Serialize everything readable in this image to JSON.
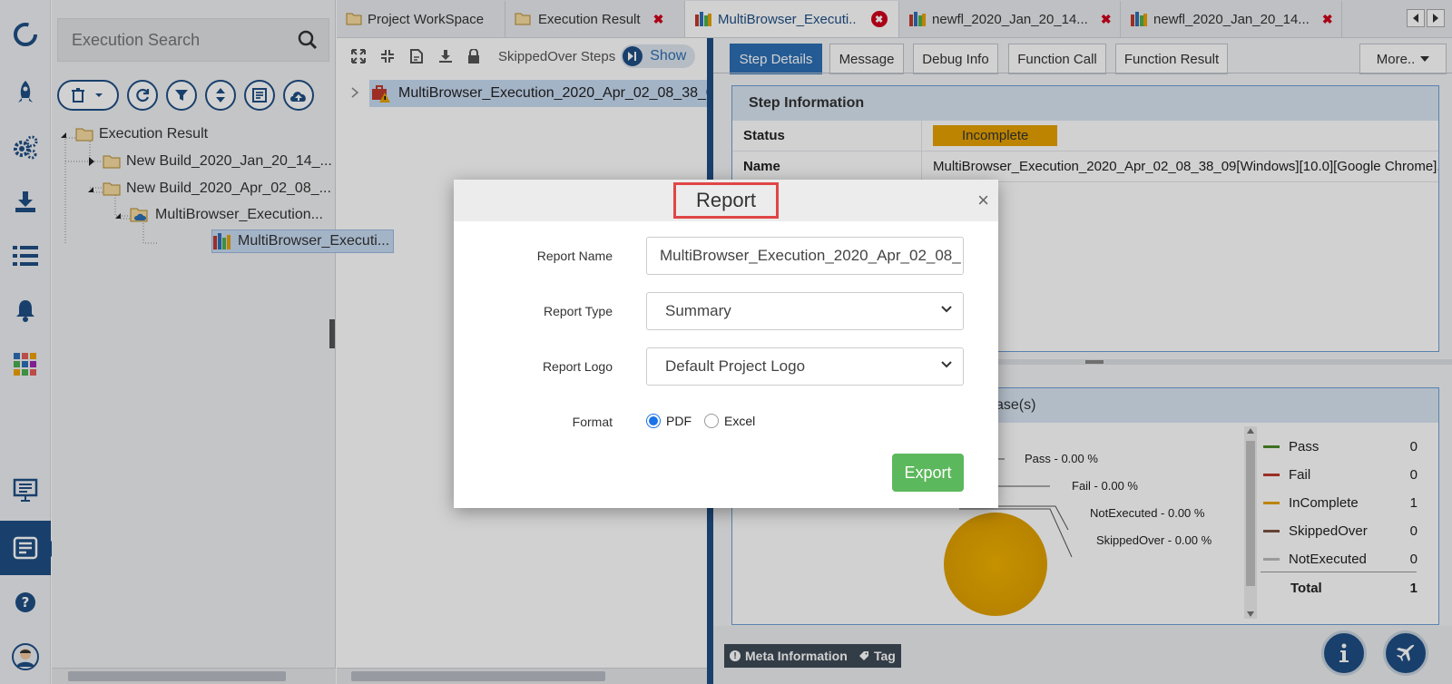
{
  "tree": {
    "search_placeholder": "Execution Search",
    "nodes": [
      {
        "label": "Execution Result"
      },
      {
        "label": "New Build_2020_Jan_20_14_..."
      },
      {
        "label": "New Build_2020_Apr_02_08_..."
      },
      {
        "label": "MultiBrowser_Execution..."
      },
      {
        "label": "MultiBrowser_Executi..."
      }
    ]
  },
  "tabs": [
    {
      "label": "Project WorkSpace"
    },
    {
      "label": "Execution Result",
      "close": "✖"
    },
    {
      "label": "MultiBrowser_Executi..",
      "close": "✖"
    },
    {
      "label": "newfl_2020_Jan_20_14...",
      "close": "✖"
    },
    {
      "label": "newfl_2020_Jan_20_14...",
      "close": "✖"
    }
  ],
  "mid": {
    "skipped_label": "SkippedOver Steps",
    "show_label": "Show",
    "selected_node": "MultiBrowser_Execution_2020_Apr_02_08_38_0..."
  },
  "right": {
    "tabs": [
      "Step Details",
      "Message",
      "Debug Info",
      "Function Call",
      "Function Result",
      "More.."
    ],
    "step_info": {
      "title": "Step Information",
      "status_label": "Status",
      "status_value": "Incomplete",
      "name_label": "Name",
      "name_value": "MultiBrowser_Execution_2020_Apr_02_08_38_09[Windows][10.0][Google Chrome]..."
    },
    "testcase": {
      "title_tail": "ase(s)",
      "pie_labels": [
        "Pass - 0.00 %",
        "Fail - 0.00 %",
        "NotExecuted - 0.00 %",
        "SkippedOver - 0.00 %"
      ],
      "legend": [
        {
          "name": "Pass",
          "count": "0",
          "color": "#4a8a2a"
        },
        {
          "name": "Fail",
          "count": "0",
          "color": "#c0392b"
        },
        {
          "name": "InComplete",
          "count": "1",
          "color": "#e6a100"
        },
        {
          "name": "SkippedOver",
          "count": "0",
          "color": "#7a5240"
        },
        {
          "name": "NotExecuted",
          "count": "0",
          "color": "#bdbdbd"
        }
      ],
      "total_label": "Total",
      "total_value": "1"
    },
    "bottom": {
      "meta": "Meta Information",
      "tag": "Tag"
    }
  },
  "modal": {
    "title": "Report",
    "close": "×",
    "report_name_label": "Report Name",
    "report_name_value": "MultiBrowser_Execution_2020_Apr_02_08_",
    "report_type_label": "Report Type",
    "report_type_value": "Summary",
    "report_logo_label": "Report Logo",
    "report_logo_value": "Default Project Logo",
    "format_label": "Format",
    "format_pdf": "PDF",
    "format_excel": "Excel",
    "export_label": "Export"
  },
  "colors": {
    "brand": "#1f4f84",
    "accent": "#2d6fb5",
    "incomplete": "#e6a100",
    "export": "#5cb85c"
  }
}
